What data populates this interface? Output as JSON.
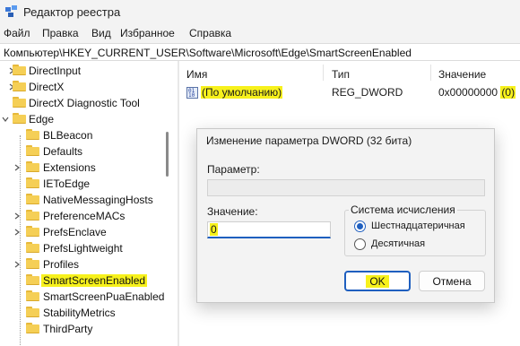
{
  "window": {
    "title": "Редактор реестра",
    "icon": "registry-editor-icon"
  },
  "menu": [
    "Файл",
    "Правка",
    "Вид",
    "Избранное",
    "Справка"
  ],
  "address": "Компьютер\\HKEY_CURRENT_USER\\Software\\Microsoft\\Edge\\SmartScreenEnabled",
  "tree": {
    "items": [
      {
        "label": "DirectInput",
        "expanded": false,
        "level": 0
      },
      {
        "label": "DirectX",
        "expanded": false,
        "level": 0
      },
      {
        "label": "DirectX Diagnostic Tool",
        "expanded": false,
        "level": 0
      },
      {
        "label": "Edge",
        "expanded": true,
        "level": 0
      },
      {
        "label": "BLBeacon",
        "level": 1
      },
      {
        "label": "Defaults",
        "level": 1
      },
      {
        "label": "Extensions",
        "expandable": true,
        "level": 1
      },
      {
        "label": "IEToEdge",
        "level": 1
      },
      {
        "label": "NativeMessagingHosts",
        "level": 1
      },
      {
        "label": "PreferenceMACs",
        "expandable": true,
        "level": 1
      },
      {
        "label": "PrefsEnclave",
        "expandable": true,
        "level": 1
      },
      {
        "label": "PrefsLightweight",
        "level": 1
      },
      {
        "label": "Profiles",
        "expandable": true,
        "level": 1
      },
      {
        "label": "SmartScreenEnabled",
        "level": 1,
        "selected": true
      },
      {
        "label": "SmartScreenPuaEnabled",
        "level": 1
      },
      {
        "label": "StabilityMetrics",
        "level": 1
      },
      {
        "label": "ThirdParty",
        "level": 1
      }
    ]
  },
  "list": {
    "headers": {
      "name": "Имя",
      "type": "Тип",
      "value": "Значение"
    },
    "rows": [
      {
        "name": "(По умолчанию)",
        "type": "REG_DWORD",
        "value_prefix": "0x00000000 ",
        "value_hl": "(0)"
      }
    ]
  },
  "dialog": {
    "title": "Изменение параметра DWORD (32 бита)",
    "param_label": "Параметр:",
    "param_value": "",
    "value_label": "Значение:",
    "value": "0",
    "base_group": "Система исчисления",
    "radio_hex": "Шестнадцатеричная",
    "radio_dec": "Десятичная",
    "selected_base": "hex",
    "ok": "OK",
    "cancel": "Отмена"
  },
  "colors": {
    "highlight": "#f7f11c",
    "accent": "#1f5fbf",
    "folder": "#f5cf56"
  }
}
